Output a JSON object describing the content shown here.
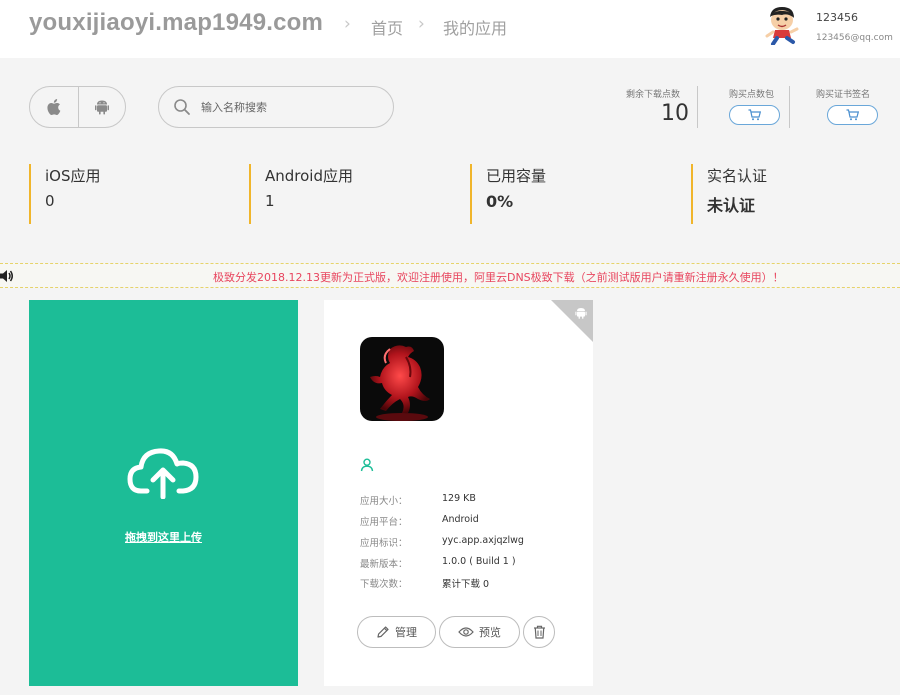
{
  "header": {
    "site_title": "youxijiaoyi.map1949.com",
    "breadcrumb_sep": "›",
    "breadcrumbs": [
      "首页",
      "我的应用"
    ],
    "user_name": "123456",
    "user_email": "123456@qq.com"
  },
  "toolbar": {
    "platforms": [
      {
        "name": "ios",
        "icon": "apple-icon"
      },
      {
        "name": "android",
        "icon": "android-icon"
      }
    ],
    "search_placeholder": "输入名称搜索",
    "download_label": "剩余下载点数",
    "download_count": "10",
    "buy_points_label": "购买点数包",
    "buy_cert_label": "购买证书签名"
  },
  "stats": [
    {
      "label": "iOS应用",
      "value": "0"
    },
    {
      "label": "Android应用",
      "value": "1"
    },
    {
      "label": "已用容量",
      "value": "0%"
    },
    {
      "label": "实名认证",
      "value": "未认证"
    }
  ],
  "notice": {
    "text": "极致分发2018.12.13更新为正式版，欢迎注册使用，阿里云DNS极致下载（之前测试版用户请重新注册永久使用）！"
  },
  "upload": {
    "label": "拖拽到这里上传"
  },
  "app": {
    "platform_icon": "android-icon",
    "info": [
      {
        "label": "应用大小：",
        "value": "129 KB"
      },
      {
        "label": "应用平台：",
        "value": "Android"
      },
      {
        "label": "应用标识：",
        "value": "yyc.app.axjqzlwg"
      },
      {
        "label": "最新版本：",
        "value": "1.0.0 ( Build 1 )"
      },
      {
        "label": "下载次数：",
        "value": "累计下载 0"
      }
    ],
    "actions": {
      "manage": "管理",
      "preview": "预览"
    }
  },
  "colors": {
    "accent_green": "#1cbd97",
    "stat_border": "#f0b52b",
    "notice_text": "#e8455e",
    "cart_blue": "#6aa7d9"
  }
}
